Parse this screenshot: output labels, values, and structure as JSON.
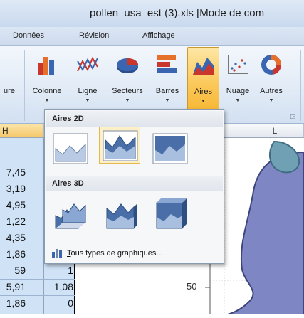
{
  "window": {
    "title": "pollen_usa_est (3).xls  [Mode de com"
  },
  "tabs": [
    {
      "label": "Données"
    },
    {
      "label": "Révision"
    },
    {
      "label": "Affichage"
    }
  ],
  "ribbon": {
    "partial_label": "ure",
    "buttons": [
      {
        "label": "Colonne",
        "icon": "column-chart-icon"
      },
      {
        "label": "Ligne",
        "icon": "line-chart-icon"
      },
      {
        "label": "Secteurs",
        "icon": "pie-chart-icon"
      },
      {
        "label": "Barres",
        "icon": "bar-chart-icon"
      },
      {
        "label": "Aires",
        "icon": "area-chart-icon",
        "active": true
      },
      {
        "label": "Nuage",
        "icon": "scatter-chart-icon"
      },
      {
        "label": "Autres",
        "icon": "other-charts-icon"
      }
    ]
  },
  "gallery": {
    "section_2d": "Aires 2D",
    "section_3d": "Aires 3D",
    "footer": "Tous types de graphiques..."
  },
  "sheet": {
    "columns": {
      "h": "H",
      "l": "L"
    },
    "col_h_values": [
      "7,45",
      "3,19",
      "4,95",
      "1,22",
      "4,35",
      "1,86",
      "59",
      "5,91",
      "1,86"
    ],
    "col_i_values": [
      "1",
      "1,08",
      "0"
    ],
    "y_tick": "50"
  },
  "colors": {
    "active_button": "#f7b733",
    "selection": "#cfe2f6",
    "chart_fill": "#7f86c4"
  }
}
